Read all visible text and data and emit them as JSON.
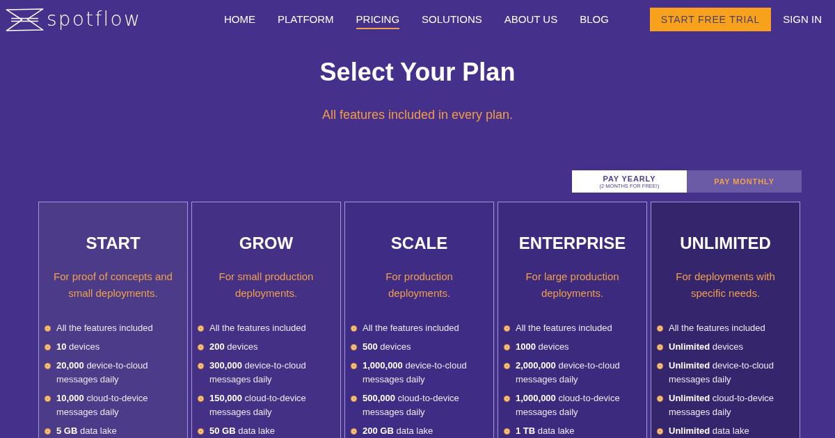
{
  "nav": {
    "logo": "spotflow",
    "links": [
      {
        "label": "HOME",
        "selected": false
      },
      {
        "label": "PLATFORM",
        "selected": false
      },
      {
        "label": "PRICING",
        "selected": true
      },
      {
        "label": "SOLUTIONS",
        "selected": false
      },
      {
        "label": "ABOUT US",
        "selected": false
      },
      {
        "label": "BLOG",
        "selected": false
      }
    ],
    "cta": "START FREE TRIAL",
    "sign_in": "SIGN IN"
  },
  "hero": {
    "title": "Select Your Plan",
    "subtitle": "All features included in every plan."
  },
  "billing_toggle": [
    {
      "label": "PAY YEARLY",
      "note": "(2 MONTHS FOR FREE!)",
      "selected": true
    },
    {
      "label": "PAY MONTHLY",
      "selected": false
    }
  ],
  "plans": [
    {
      "name": "START",
      "description": "For proof of concepts and small deployments.",
      "features": [
        "All the features included",
        "**10** devices",
        "**20,000** device-to-cloud messages daily",
        "**10,000** cloud-to-device messages daily",
        "**5 GB** data lake"
      ]
    },
    {
      "name": "GROW",
      "description": "For small production deployments.",
      "features": [
        "All the features included",
        "**200** devices",
        "**300,000** device-to-cloud messages daily",
        "**150,000** cloud-to-device messages daily",
        "**50 GB** data lake"
      ]
    },
    {
      "name": "SCALE",
      "description": "For production deployments.",
      "features": [
        "All the features included",
        "**500** devices",
        "**1,000,000** device-to-cloud messages daily",
        "**500,000** cloud-to-device messages daily",
        "**200 GB** data lake"
      ]
    },
    {
      "name": "ENTERPRISE",
      "description": "For large production deployments.",
      "features": [
        "All the features included",
        "**1000** devices",
        "**2,000,000** device-to-cloud messages daily",
        "**1,000,000** cloud-to-device messages daily",
        "**1 TB** data lake"
      ]
    },
    {
      "name": "UNLIMITED",
      "description": "For deployments with specific needs.",
      "features": [
        "All the features included",
        "**Unlimited** devices",
        "**Unlimited** device-to-cloud messages daily",
        "**Unlimited** cloud-to-device messages daily",
        "**Unlimited** data lake"
      ]
    }
  ]
}
